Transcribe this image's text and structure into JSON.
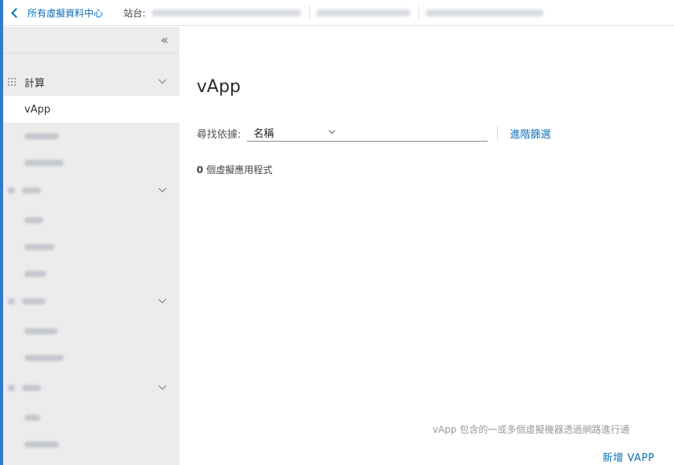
{
  "topbar": {
    "back_label": "所有虛擬資料中心",
    "site_label": "站台:"
  },
  "sidebar": {
    "collapse_glyph": "«",
    "groups": [
      {
        "label": "計算",
        "icon": "grid-icon"
      },
      {
        "label": "",
        "icon": "network-icon"
      },
      {
        "label": "",
        "icon": "storage-icon"
      },
      {
        "label": "",
        "icon": "settings-icon"
      }
    ],
    "items": [
      {
        "label": "vApp",
        "active": true
      }
    ]
  },
  "main": {
    "title": "vApp",
    "search_label": "尋找依據:",
    "search_field_value": "名稱",
    "advanced_filter": "進階篩選",
    "count_value": "0",
    "count_label": "個虛擬應用程式",
    "empty_description": "vApp 包含的一或多個虛擬機器透過網路進行通",
    "new_button": "新增 VAPP"
  },
  "colors": {
    "accent": "#0b6fb8",
    "frame": "#2f7ccf",
    "sidebar_bg": "#ececec"
  }
}
